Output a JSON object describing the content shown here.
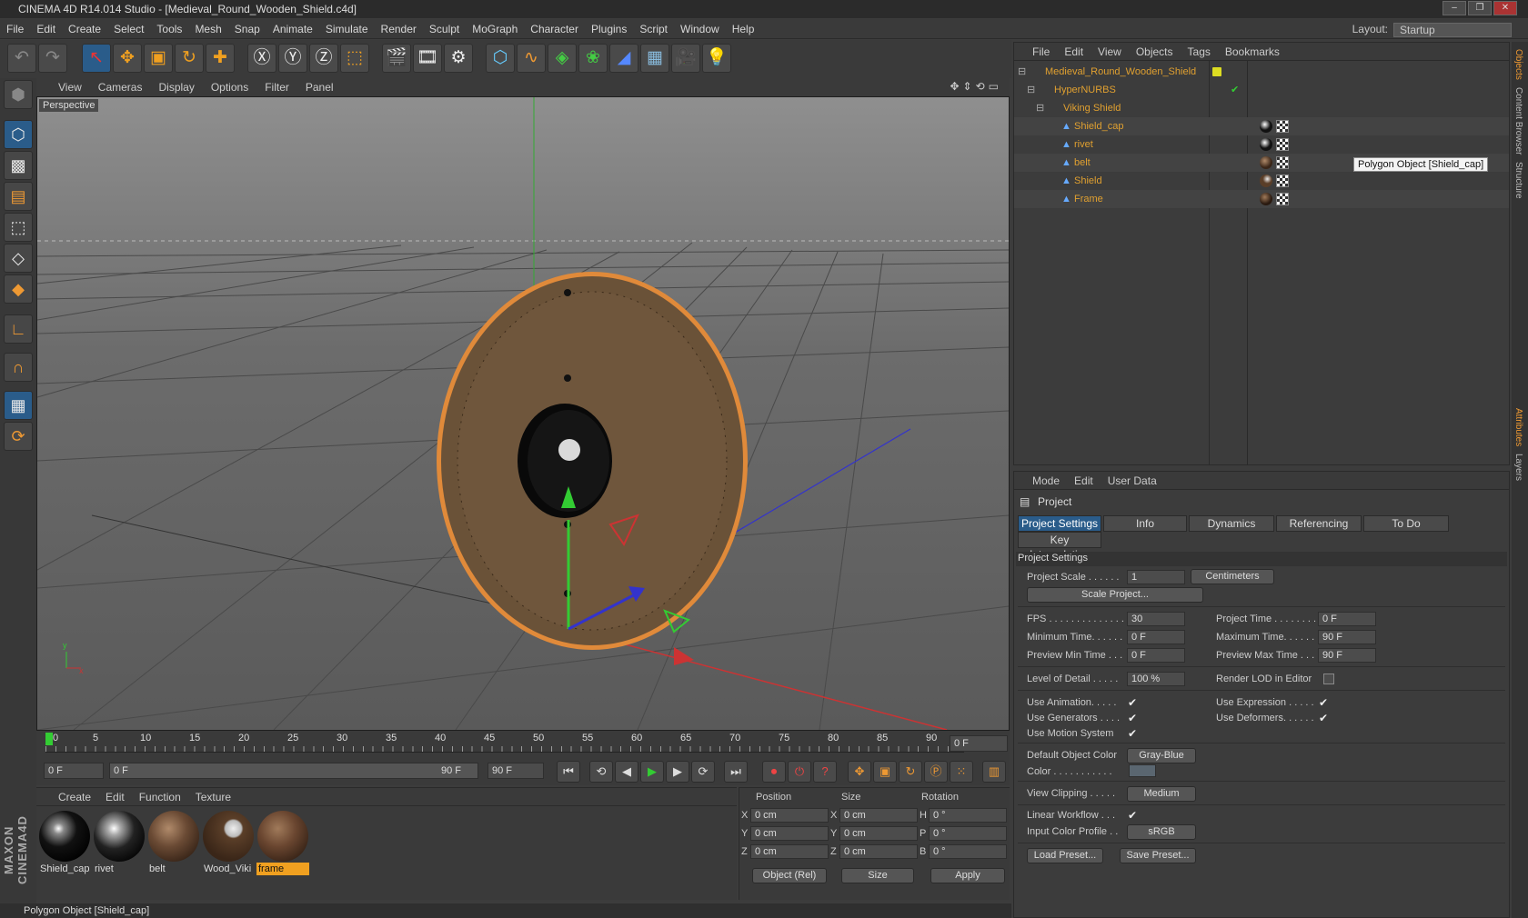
{
  "window": {
    "title": "CINEMA 4D R14.014 Studio - [Medieval_Round_Wooden_Shield.c4d]"
  },
  "menu": [
    "File",
    "Edit",
    "Create",
    "Select",
    "Tools",
    "Mesh",
    "Snap",
    "Animate",
    "Simulate",
    "Render",
    "Sculpt",
    "MoGraph",
    "Character",
    "Plugins",
    "Script",
    "Window",
    "Help"
  ],
  "layout": {
    "label": "Layout:",
    "value": "Startup"
  },
  "viewport": {
    "menu": [
      "View",
      "Cameras",
      "Display",
      "Options",
      "Filter",
      "Panel"
    ],
    "label": "Perspective"
  },
  "timeline": {
    "ticks": [
      "0",
      "5",
      "10",
      "15",
      "20",
      "25",
      "30",
      "35",
      "40",
      "45",
      "50",
      "55",
      "60",
      "65",
      "70",
      "75",
      "80",
      "85",
      "90"
    ],
    "current": "0 F"
  },
  "frames": {
    "start": "0 F",
    "slider_start": "0 F",
    "slider_end": "90 F",
    "end": "90 F"
  },
  "materials": {
    "menu": [
      "Create",
      "Edit",
      "Function",
      "Texture"
    ],
    "items": [
      {
        "label": "Shield_cap",
        "color": "#111"
      },
      {
        "label": "rivet",
        "color": "#222"
      },
      {
        "label": "belt",
        "color": "#6a4a34"
      },
      {
        "label": "Wood_Viki",
        "color": "#5a3e28"
      },
      {
        "label": "frame",
        "color": "#6a4630"
      }
    ]
  },
  "coords": {
    "headers": [
      "Position",
      "Size",
      "Rotation"
    ],
    "rows": [
      {
        "a": "X",
        "p": "0 cm",
        "b": "X",
        "s": "0 cm",
        "c": "H",
        "r": "0 °"
      },
      {
        "a": "Y",
        "p": "0 cm",
        "b": "Y",
        "s": "0 cm",
        "c": "P",
        "r": "0 °"
      },
      {
        "a": "Z",
        "p": "0 cm",
        "b": "Z",
        "s": "0 cm",
        "c": "B",
        "r": "0 °"
      }
    ],
    "mode": "Object (Rel)",
    "size_mode": "Size",
    "apply": "Apply"
  },
  "status": "Polygon Object [Shield_cap]",
  "objects": {
    "menu": [
      "File",
      "Edit",
      "View",
      "Objects",
      "Tags",
      "Bookmarks"
    ],
    "items": [
      {
        "name": "Medieval_Round_Wooden_Shield"
      },
      {
        "name": "HyperNURBS"
      },
      {
        "name": "Viking Shield"
      },
      {
        "name": "Shield_cap"
      },
      {
        "name": "rivet"
      },
      {
        "name": "belt"
      },
      {
        "name": "Shield"
      },
      {
        "name": "Frame"
      }
    ],
    "tooltip": "Polygon Object [Shield_cap]"
  },
  "attributes": {
    "menu": [
      "Mode",
      "Edit",
      "User Data"
    ],
    "title": "Project",
    "tabs": [
      "Project Settings",
      "Info",
      "Dynamics",
      "Referencing",
      "To Do"
    ],
    "tab2": "Key Interpolation",
    "section": "Project Settings",
    "project_scale_label": "Project Scale . . . . . .",
    "project_scale": "1",
    "scale_unit": "Centimeters",
    "scale_project": "Scale Project...",
    "fps_label": "FPS . . . . . . . . . . . . . .",
    "fps": "30",
    "ptime_label": "Project Time . . . . . . . .",
    "ptime": "0 F",
    "mintime_label": "Minimum Time. . . . . .",
    "mintime": "0 F",
    "maxtime_label": "Maximum Time. . . . . .",
    "maxtime": "90 F",
    "pmin_label": "Preview Min Time . . .",
    "pmin": "0 F",
    "pmax_label": "Preview Max Time . . .",
    "pmax": "90 F",
    "lod_label": "Level of Detail . . . . .",
    "lod": "100 %",
    "rlod_label": "Render LOD in Editor",
    "useanim_label": "Use Animation. . . . .",
    "useexpr_label": "Use Expression . . . . .",
    "usegen_label": "Use Generators . . . .",
    "usedef_label": "Use Deformers. . . . . .",
    "usems_label": "Use Motion System",
    "doc_label": "Default Object Color",
    "doc": "Gray-Blue",
    "color_label": "Color . . . . . . . . . . .",
    "vclip_label": "View Clipping . . . . .",
    "vclip": "Medium",
    "lw_label": "Linear Workflow . . .",
    "icp_label": "Input Color Profile . .",
    "icp": "sRGB",
    "load": "Load Preset...",
    "save": "Save Preset..."
  },
  "sidetabs": [
    "Objects",
    "Content Browser",
    "Structure",
    "Attributes",
    "Layers"
  ]
}
